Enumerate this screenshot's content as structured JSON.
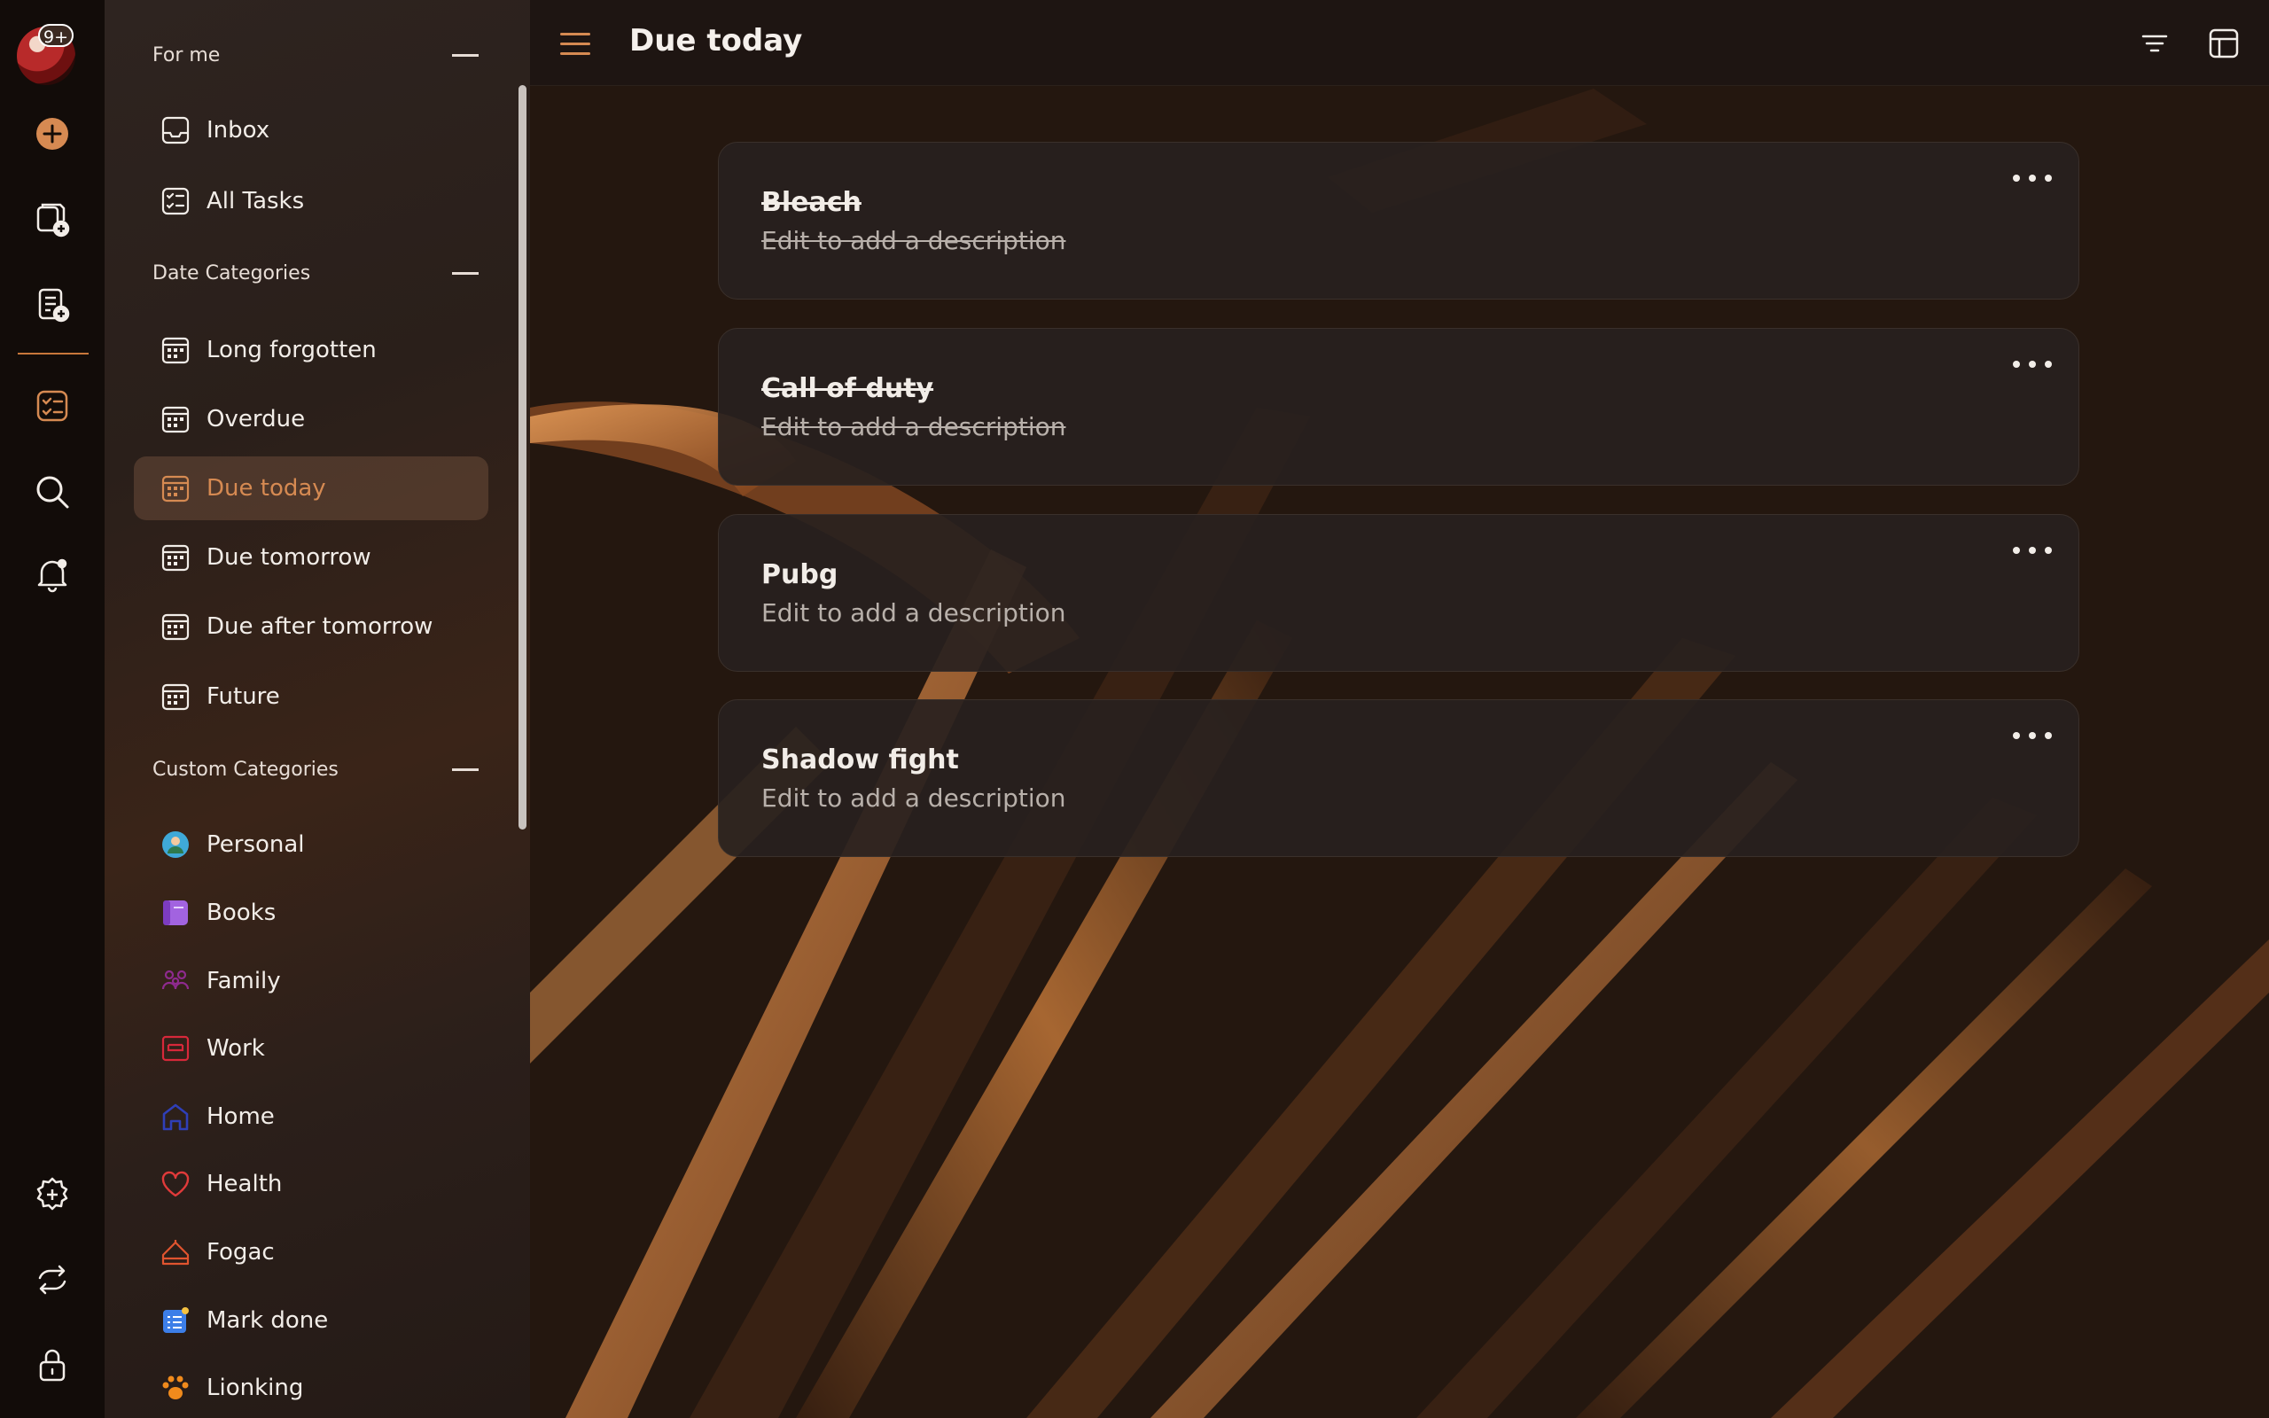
{
  "avatar": {
    "badge": "9+"
  },
  "colors": {
    "accent": "#d68a52",
    "rail": "#120c09",
    "sidebar": "#2a1f1a",
    "card": "#28211e"
  },
  "rail": {
    "icons": [
      "add-icon",
      "new-collection-icon",
      "new-note-icon",
      "tasks-icon",
      "search-icon",
      "notifications-icon",
      "settings-icon",
      "sync-icon",
      "lock-icon"
    ]
  },
  "sidebar": {
    "sections": {
      "for_me": "For me",
      "date_categories": "Date Categories",
      "custom_categories": "Custom Categories"
    },
    "for_me_items": [
      {
        "label": "Inbox",
        "icon": "inbox-icon"
      },
      {
        "label": "All Tasks",
        "icon": "all-tasks-icon"
      }
    ],
    "date_items": [
      {
        "label": "Long forgotten",
        "icon": "calendar-icon"
      },
      {
        "label": "Overdue",
        "icon": "calendar-icon"
      },
      {
        "label": "Due today",
        "icon": "calendar-icon",
        "active": true
      },
      {
        "label": "Due tomorrow",
        "icon": "calendar-icon"
      },
      {
        "label": "Due after tomorrow",
        "icon": "calendar-icon"
      },
      {
        "label": "Future",
        "icon": "calendar-icon"
      }
    ],
    "custom_items": [
      {
        "label": "Personal",
        "icon": "person-icon",
        "color": "#3fa9d8"
      },
      {
        "label": "Books",
        "icon": "book-icon",
        "color": "#a263e0"
      },
      {
        "label": "Family",
        "icon": "family-icon",
        "color": "#8e2a8e"
      },
      {
        "label": "Work",
        "icon": "work-icon",
        "color": "#d7283a"
      },
      {
        "label": "Home",
        "icon": "home-icon",
        "color": "#2f3fb8"
      },
      {
        "label": "Health",
        "icon": "heart-icon",
        "color": "#e03a3a"
      },
      {
        "label": "Fogac",
        "icon": "cake-icon",
        "color": "#e0542f"
      },
      {
        "label": "Mark done",
        "icon": "checklist-icon",
        "color": "#3c7ee8"
      },
      {
        "label": "Lionking",
        "icon": "paw-icon",
        "color": "#f08a1c"
      }
    ]
  },
  "header": {
    "title": "Due today"
  },
  "tasks": [
    {
      "title": "Bleach",
      "description": "Edit to add a description",
      "done": true
    },
    {
      "title": "Call of duty",
      "description": "Edit to add a description",
      "done": true
    },
    {
      "title": "Pubg",
      "description": "Edit to add a description",
      "done": false
    },
    {
      "title": "Shadow fight",
      "description": "Edit to add a description",
      "done": false
    }
  ]
}
